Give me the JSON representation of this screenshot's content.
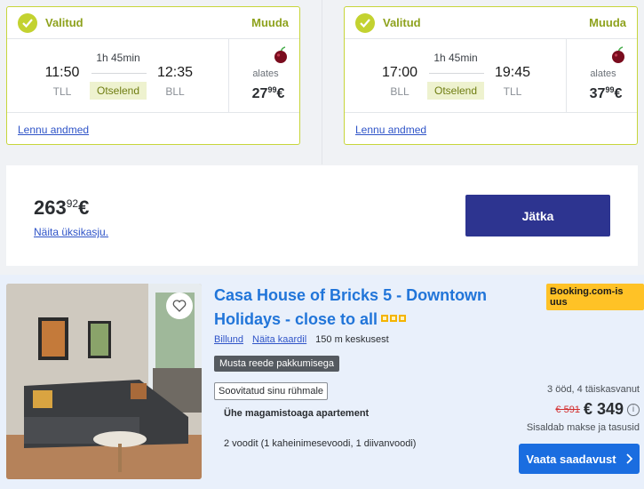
{
  "flights": [
    {
      "status": "Valitud",
      "change": "Muuda",
      "dep_time": "11:50",
      "dep_code": "TLL",
      "arr_time": "12:35",
      "arr_code": "BLL",
      "duration": "1h 45min",
      "direct": "Otselend",
      "from_label": "alates",
      "price_main": "27",
      "price_cents": "99",
      "currency": "€",
      "details_link": "Lennu andmed"
    },
    {
      "status": "Valitud",
      "change": "Muuda",
      "dep_time": "17:00",
      "dep_code": "BLL",
      "arr_time": "19:45",
      "arr_code": "TLL",
      "duration": "1h 45min",
      "direct": "Otselend",
      "from_label": "alates",
      "price_main": "37",
      "price_cents": "99",
      "currency": "€",
      "details_link": "Lennu andmed"
    }
  ],
  "summary": {
    "total_main": "263",
    "total_cents": "92",
    "currency": "€",
    "detail_link": "Näita üksikasju.",
    "continue_button": "Jätka"
  },
  "hotel": {
    "title": "Casa House of Bricks 5 - Downtown Holidays - close to all",
    "star_count": 3,
    "badge": "Booking.com-is uus",
    "location": "Billund",
    "map_link": "Näita kaardil",
    "distance": "150 m keskusest",
    "promo": "Musta reede pakkumisega",
    "recommended": "Soovitatud sinu rühmale",
    "apartment": "Ühe magamistoaga apartement",
    "beds": "2 voodit (1 kaheinimesevoodi, 1 diivanvoodi)",
    "stay": "3 ööd, 4 täiskasvanut",
    "old_price": "€ 591",
    "new_price": "€ 349",
    "info": "i",
    "taxes": "Sisaldab makse ja tasusid",
    "availability_button": "Vaata saadavust"
  },
  "colors": {
    "accent_green": "#c3d230",
    "primary_dark": "#2d3490",
    "link_blue": "#2f54c8",
    "hotel_title": "#2175d9",
    "booking_badge": "#ffc226"
  }
}
